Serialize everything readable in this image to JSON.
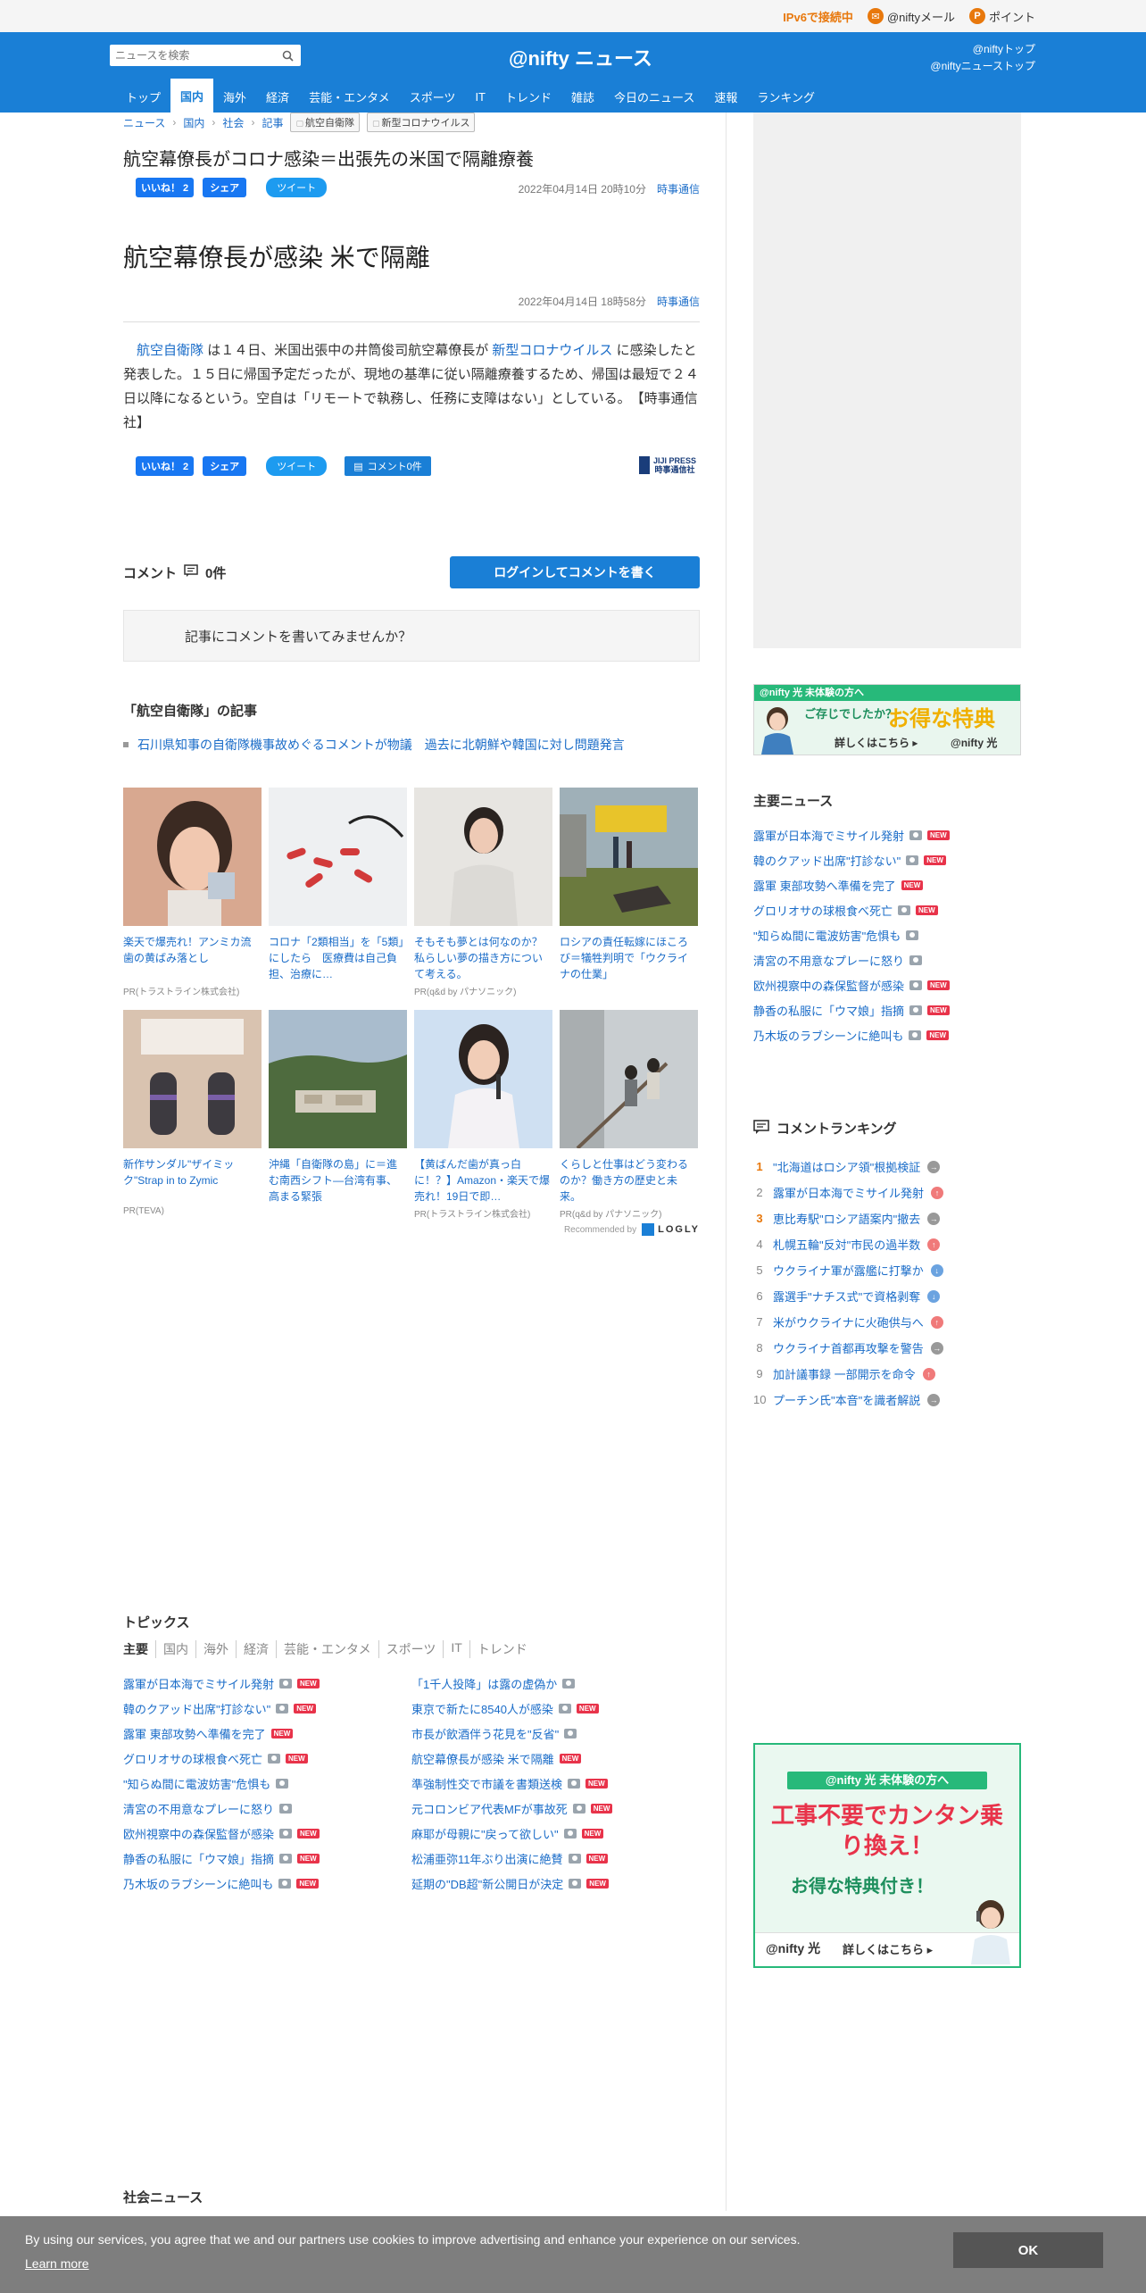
{
  "util": {
    "ipv6": "IPv6で接続中",
    "mail": "@niftyメール",
    "point": "ポイント"
  },
  "header": {
    "search_placeholder": "ニュースを検索",
    "logo": "@nifty ニュース",
    "link_top": "@niftyトップ",
    "link_news_top": "@niftyニューストップ"
  },
  "nav": [
    "トップ",
    "国内",
    "海外",
    "経済",
    "芸能・エンタメ",
    "スポーツ",
    "IT",
    "トレンド",
    "雑誌",
    "今日のニュース",
    "速報",
    "ランキング"
  ],
  "breadcrumb": {
    "items": [
      "ニュース",
      "国内",
      "社会",
      "記事"
    ],
    "tags": [
      "航空自衛隊",
      "新型コロナウイルス"
    ]
  },
  "article": {
    "headline": "航空幕僚長がコロナ感染＝出張先の米国で隔離療養",
    "like_label": "いいね！ 2",
    "share_label": "シェア",
    "tweet_label": "ツイート",
    "date1": "2022年04月14日 20時10分",
    "source": "時事通信",
    "title": "航空幕僚長が感染 米で隔離",
    "date2": "2022年04月14日 18時58分",
    "body_link1": "航空自衛隊",
    "body_part1": "は１４日、米国出張中の井筒俊司航空幕僚長が",
    "body_link2": "新型コロナウイルス",
    "body_part2": "に感染したと発表した。１５日に帰国予定だったが、現地の基準に従い隔離療養するため、帰国は最短で２４日以降になるという。空自は「リモートで執務し、任務に支障はない」としている。　【時事通信社】",
    "comment_btn": "コメント0件",
    "jiji_en": "JIJI PRESS",
    "jiji_jp": "時事通信社"
  },
  "comments": {
    "label": "コメント",
    "count": "0件",
    "login_btn": "ログインしてコメントを書く",
    "prompt": "記事にコメントを書いてみませんか？"
  },
  "related": {
    "title": "「航空自衛隊」の記事",
    "item": "石川県知事の自衛隊機事故めぐるコメントが物議　過去に北朝鮮や韓国に対し問題発言"
  },
  "reco": [
    {
      "cap": "楽天で爆売れ！アンミカ流歯の黄ばみ落とし",
      "pr": "PR(トラストライン株式会社)"
    },
    {
      "cap": "コロナ「2類相当」を「5類」にしたら　医療費は自己負担、治療に…",
      "pr": ""
    },
    {
      "cap": "そもそも夢とは何なのか？私らしい夢の描き方について考える。",
      "pr": "PR(q&d by パナソニック)"
    },
    {
      "cap": "ロシアの責任転嫁にほころび＝犠牲判明で「ウクライナの仕業」",
      "pr": ""
    },
    {
      "cap": "新作サンダル\"ザイミック\"Strap in to Zymic",
      "pr": "PR(TEVA)"
    },
    {
      "cap": "沖縄「自衛隊の島」に＝進む南西シフト―台湾有事、高まる緊張",
      "pr": ""
    },
    {
      "cap": "【黄ばんだ歯が真っ白に！？】Amazon・楽天で爆売れ！19日で即…",
      "pr": "PR(トラストライン株式会社)"
    },
    {
      "cap": "くらしと仕事はどう変わるのか？働き方の歴史と未来。",
      "pr": "PR(q&d by パナソニック)"
    }
  ],
  "recommended_by": "Recommended by",
  "logly": "LOGLY",
  "topics": {
    "title": "トピックス",
    "tabs": [
      "主要",
      "国内",
      "海外",
      "経済",
      "芸能・エンタメ",
      "スポーツ",
      "IT",
      "トレンド"
    ],
    "left": [
      {
        "t": "露軍が日本海でミサイル発射",
        "cam": true,
        "new": true
      },
      {
        "t": "韓のクアッド出席\"打診ない\"",
        "cam": true,
        "new": true
      },
      {
        "t": "露軍 東部攻勢へ準備を完了",
        "cam": false,
        "new": true
      },
      {
        "t": "グロリオサの球根食べ死亡",
        "cam": true,
        "new": true
      },
      {
        "t": "\"知らぬ間に電波妨害\"危惧も",
        "cam": true,
        "new": false
      },
      {
        "t": "清宮の不用意なプレーに怒り",
        "cam": true,
        "new": false
      },
      {
        "t": "欧州視察中の森保監督が感染",
        "cam": true,
        "new": true
      },
      {
        "t": "静香の私服に「ウマ娘」指摘",
        "cam": true,
        "new": true
      },
      {
        "t": "乃木坂のラブシーンに絶叫も",
        "cam": true,
        "new": true
      }
    ],
    "right": [
      {
        "t": "「1千人投降」は露の虚偽か",
        "cam": true,
        "new": false
      },
      {
        "t": "東京で新たに8540人が感染",
        "cam": true,
        "new": true
      },
      {
        "t": "市長が飲酒伴う花見を\"反省\"",
        "cam": true,
        "new": false
      },
      {
        "t": "航空幕僚長が感染 米で隔離",
        "cam": false,
        "new": true
      },
      {
        "t": "準強制性交で市議を書類送検",
        "cam": true,
        "new": true
      },
      {
        "t": "元コロンビア代表MFが事故死",
        "cam": true,
        "new": true
      },
      {
        "t": "麻耶が母親に\"戻って欲しい\"",
        "cam": true,
        "new": true
      },
      {
        "t": "松浦亜弥11年ぶり出演に絶賛",
        "cam": true,
        "new": true
      },
      {
        "t": "延期の\"DB超\"新公開日が決定",
        "cam": true,
        "new": true
      }
    ]
  },
  "social_title": "社会ニュース",
  "sidebar": {
    "banner1_top": "@nifty 光 未体験の方へ",
    "banner1_q": "ご存じでしたか？",
    "banner1_main": "お得な特典",
    "banner1_cta": "詳しくはこちら ▸",
    "banner1_logo": "@nifty 光",
    "main_news_title": "主要ニュース",
    "main_news": [
      {
        "t": "露軍が日本海でミサイル発射",
        "cam": true,
        "new": true
      },
      {
        "t": "韓のクアッド出席\"打診ない\"",
        "cam": true,
        "new": true
      },
      {
        "t": "露軍 東部攻勢へ準備を完了",
        "cam": false,
        "new": true
      },
      {
        "t": "グロリオサの球根食べ死亡",
        "cam": true,
        "new": true
      },
      {
        "t": "\"知らぬ間に電波妨害\"危惧も",
        "cam": true,
        "new": false
      },
      {
        "t": "清宮の不用意なプレーに怒り",
        "cam": true,
        "new": false
      },
      {
        "t": "欧州視察中の森保監督が感染",
        "cam": true,
        "new": true
      },
      {
        "t": "静香の私服に「ウマ娘」指摘",
        "cam": true,
        "new": true
      },
      {
        "t": "乃木坂のラブシーンに絶叫も",
        "cam": true,
        "new": true
      }
    ],
    "ranking_title": "コメントランキング",
    "ranking": [
      {
        "n": "1",
        "t": "\"北海道はロシア領\"根拠検証",
        "dir": "flat",
        "top": true
      },
      {
        "n": "2",
        "t": "露軍が日本海でミサイル発射",
        "dir": "up",
        "top": false
      },
      {
        "n": "3",
        "t": "恵比寿駅\"ロシア語案内\"撤去",
        "dir": "flat",
        "top": true
      },
      {
        "n": "4",
        "t": "札幌五輪\"反対\"市民の過半数",
        "dir": "up",
        "top": false
      },
      {
        "n": "5",
        "t": "ウクライナ軍が露艦に打撃か",
        "dir": "down",
        "top": false
      },
      {
        "n": "6",
        "t": "露選手\"ナチス式\"で資格剥奪",
        "dir": "down",
        "top": false
      },
      {
        "n": "7",
        "t": "米がウクライナに火砲供与へ",
        "dir": "up",
        "top": false
      },
      {
        "n": "8",
        "t": "ウクライナ首都再攻撃を警告",
        "dir": "flat",
        "top": false
      },
      {
        "n": "9",
        "t": "加計議事録 一部開示を命令",
        "dir": "up",
        "top": false
      },
      {
        "n": "10",
        "t": "プーチン氏\"本音\"を識者解説",
        "dir": "flat",
        "top": false
      }
    ],
    "banner2_top": "@nifty 光 未体験の方へ",
    "banner2_main": "工事不要でカンタン乗り換え！",
    "banner2_sub": "お得な特典付き！",
    "banner2_logo": "@nifty 光",
    "banner2_cta": "詳しくはこちら ▸"
  },
  "cookie": {
    "text": "By using our services, you agree that we and our partners use cookies to improve advertising and enhance your experience on our services.",
    "learn": "Learn more",
    "ok": "OK"
  },
  "colors": {
    "brand": "#1a7fd6",
    "link": "#1a6cc8",
    "new_badge": "#e8334a",
    "ipv6": "#e8780c"
  }
}
